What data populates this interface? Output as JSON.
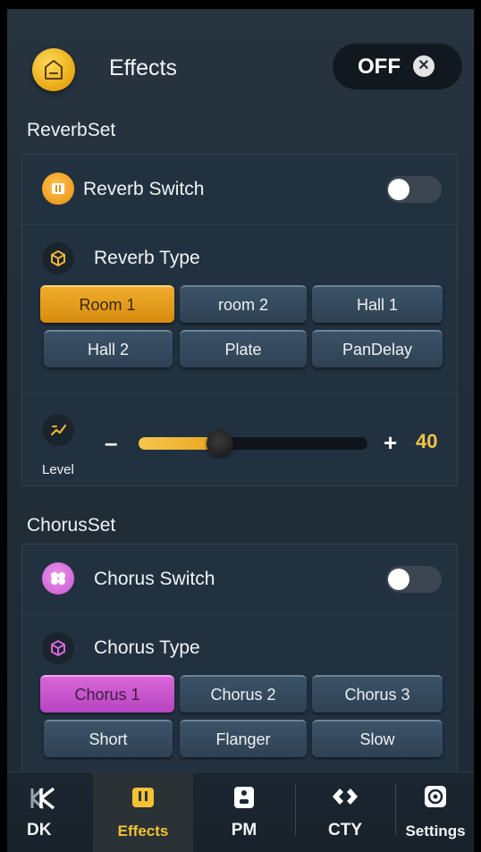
{
  "header": {
    "title": "Effects",
    "master_toggle_label": "OFF"
  },
  "reverb": {
    "section_label": "ReverbSet",
    "switch_label": "Reverb Switch",
    "switch_on": false,
    "type_label": "Reverb Type",
    "types": [
      "Room 1",
      "room 2",
      "Hall 1",
      "Hall 2",
      "Plate",
      "PanDelay"
    ],
    "selected_type": "Room 1",
    "level_label": "Level",
    "level_value": "40",
    "level_fraction": 0.31,
    "minus_label": "–",
    "plus_label": "+"
  },
  "chorus": {
    "section_label": "ChorusSet",
    "switch_label": "Chorus Switch",
    "switch_on": false,
    "type_label": "Chorus Type",
    "types": [
      "Chorus 1",
      "Chorus 2",
      "Chorus 3",
      "Short",
      "Flanger",
      "Slow"
    ],
    "selected_type": "Chorus 1"
  },
  "nav": {
    "items": [
      {
        "label": "DK",
        "icon": "dk-logo-icon"
      },
      {
        "label": "Effects",
        "icon": "effects-icon"
      },
      {
        "label": "PM",
        "icon": "pm-icon"
      },
      {
        "label": "CTY",
        "icon": "cty-icon"
      },
      {
        "label": "Settings",
        "icon": "settings-icon"
      }
    ],
    "active": "Effects"
  },
  "colors": {
    "accent_gold": "#f3c343",
    "accent_pink": "#d866d8",
    "background": "#223140"
  }
}
